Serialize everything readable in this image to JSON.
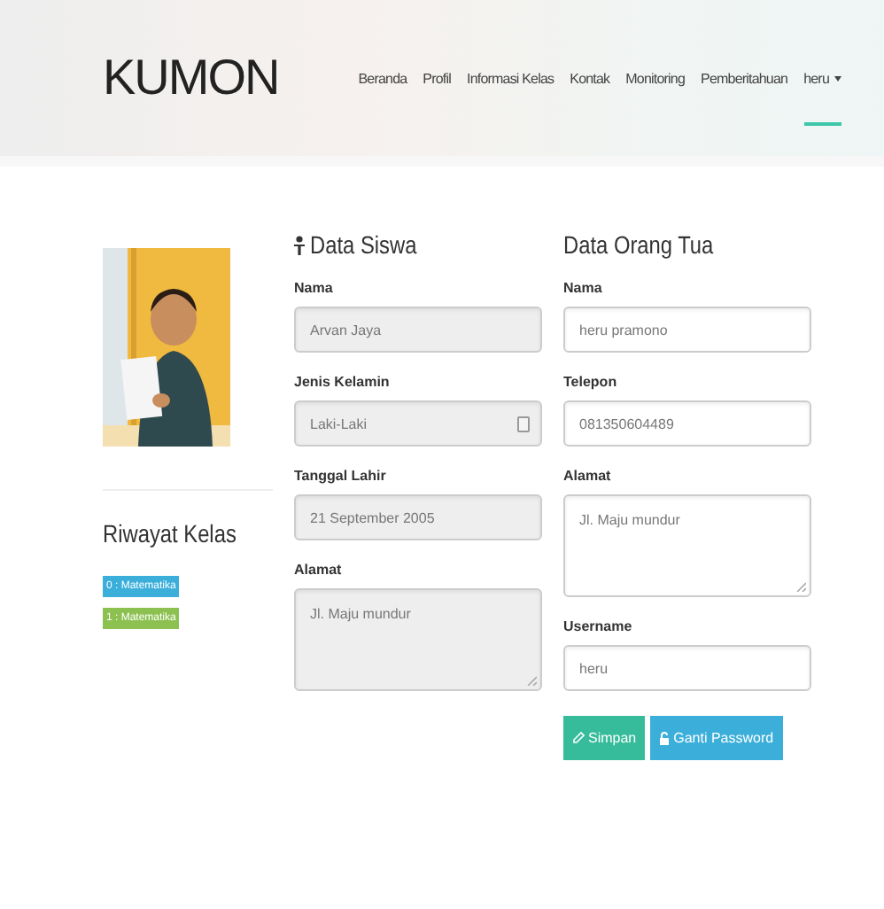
{
  "logo": "KUMON",
  "nav": [
    {
      "label": "Beranda",
      "selected": false
    },
    {
      "label": "Profil",
      "selected": false
    },
    {
      "label": "Informasi Kelas",
      "selected": false
    },
    {
      "label": "Kontak",
      "selected": false
    },
    {
      "label": "Monitoring",
      "selected": false
    },
    {
      "label": "Pemberitahuan",
      "selected": false
    },
    {
      "label": "heru",
      "selected": true,
      "dropdown": true
    }
  ],
  "sidebar": {
    "history_title": "Riwayat Kelas",
    "classes": [
      {
        "label": "0 : Matematika",
        "color": "#3bafda"
      },
      {
        "label": "1 : Matematika",
        "color": "#8cc152"
      }
    ]
  },
  "student": {
    "title": "Data Siswa",
    "fields": [
      {
        "label": "Nama",
        "value": "Arvan Jaya",
        "kind": "input",
        "disabled": true
      },
      {
        "label": "Jenis Kelamin",
        "value": "Laki-Laki",
        "kind": "select",
        "disabled": true
      },
      {
        "label": "Tanggal Lahir",
        "value": "21 September 2005",
        "kind": "input",
        "disabled": true
      },
      {
        "label": "Alamat",
        "value": "Jl. Maju mundur",
        "kind": "textarea",
        "disabled": true
      }
    ]
  },
  "parent": {
    "title": "Data Orang Tua",
    "fields": [
      {
        "label": "Nama",
        "value": "heru pramono",
        "kind": "input",
        "disabled": false
      },
      {
        "label": "Telepon",
        "value": "081350604489",
        "kind": "input",
        "disabled": false
      },
      {
        "label": "Alamat",
        "value": "Jl. Maju mundur",
        "kind": "textarea",
        "disabled": false
      },
      {
        "label": "Username",
        "value": "heru",
        "kind": "input",
        "disabled": false
      }
    ]
  },
  "buttons": [
    {
      "label": "Simpan",
      "kind": "save"
    },
    {
      "label": "Ganti Password",
      "kind": "password"
    }
  ]
}
